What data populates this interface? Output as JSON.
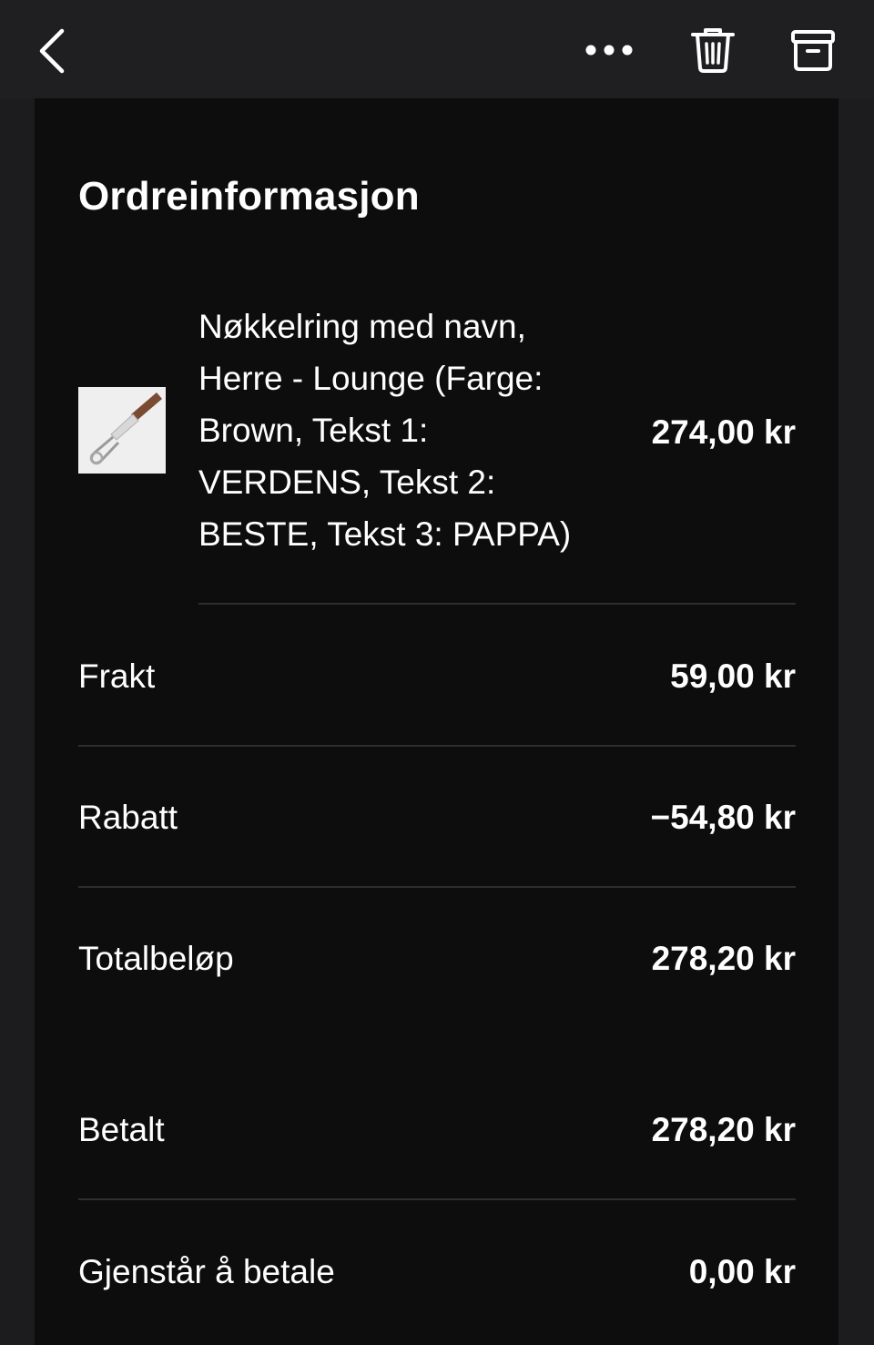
{
  "toolbar": {
    "back_icon": "chevron-left-icon",
    "more_icon": "ellipsis-icon",
    "delete_icon": "trash-icon",
    "archive_icon": "archive-box-icon"
  },
  "order": {
    "title": "Ordreinformasjon",
    "item": {
      "name_lines": [
        "Nøkkelring med navn,",
        "Herre - Lounge (Farge:",
        "Brown, Tekst 1:",
        "VERDENS, Tekst 2:",
        "BESTE, Tekst 3: PAPPA)"
      ],
      "price": "274,00 kr"
    },
    "summary": [
      {
        "label": "Frakt",
        "value": "59,00 kr"
      },
      {
        "label": "Rabatt",
        "value": "−54,80 kr"
      },
      {
        "label": "Totalbeløp",
        "value": "278,20 kr"
      },
      {
        "label": "Betalt",
        "value": "278,20 kr"
      },
      {
        "label": "Gjenstår å betale",
        "value": "0,00 kr"
      }
    ]
  },
  "colors": {
    "toolbar_bg": "#1f1f21",
    "sheet_bg": "#0d0d0d",
    "text": "#ffffff",
    "divider": "#2e2e30",
    "product_strap": "#7a4a33"
  }
}
